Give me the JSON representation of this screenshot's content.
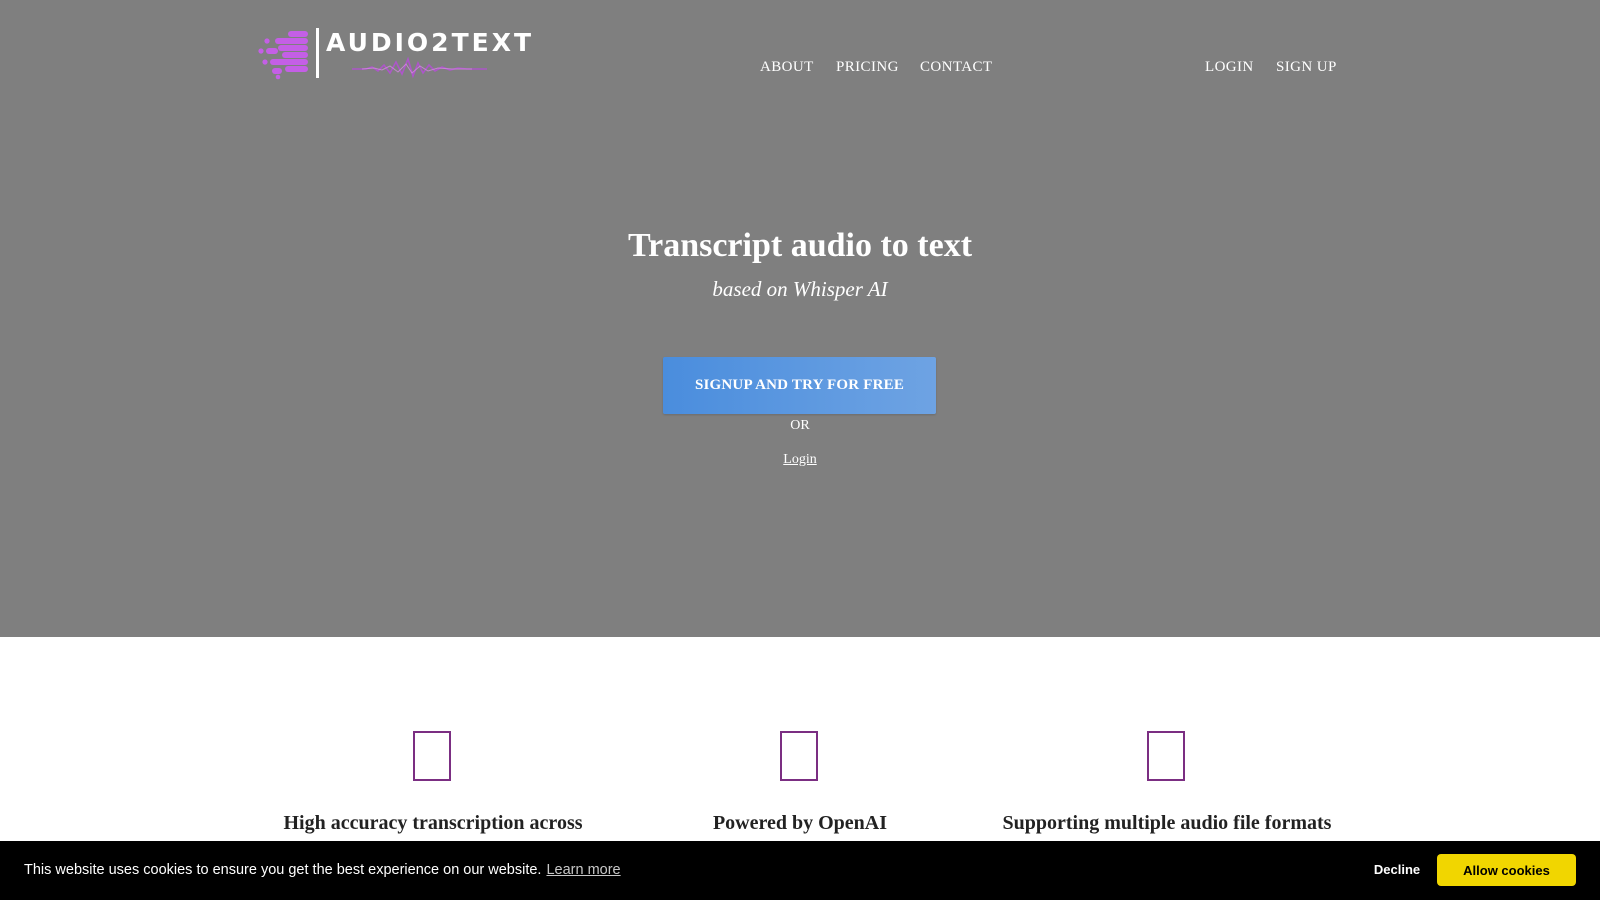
{
  "header": {
    "logo_text": "AUDIO2TEXT",
    "nav_left": [
      "ABOUT",
      "PRICING",
      "CONTACT"
    ],
    "nav_right": [
      "LOGIN",
      "SIGN UP"
    ]
  },
  "hero": {
    "title": "Transcript audio to text",
    "subtitle": "based on Whisper AI",
    "cta_label": "SIGNUP AND TRY FOR FREE",
    "or_text": "OR",
    "login_link": "Login"
  },
  "features": [
    {
      "title": "High accuracy transcription across",
      "icon": "feature-icon-placeholder"
    },
    {
      "title": "Powered by OpenAI",
      "icon": "feature-icon-placeholder"
    },
    {
      "title": "Supporting multiple audio file formats",
      "icon": "feature-icon-placeholder"
    }
  ],
  "cookie": {
    "message": "This website uses cookies to ensure you get the best experience on our website.",
    "learn_more": "Learn more",
    "decline": "Decline",
    "allow": "Allow cookies"
  },
  "colors": {
    "hero_bg": "#7f7f7f",
    "logo_accent": "#c45fe6",
    "cta_gradient_start": "#4a8ddd",
    "cta_gradient_end": "#6ea3e3",
    "feature_icon_border": "#7b2e82",
    "cookie_bar_bg": "#000000",
    "allow_button": "#f1d600"
  }
}
